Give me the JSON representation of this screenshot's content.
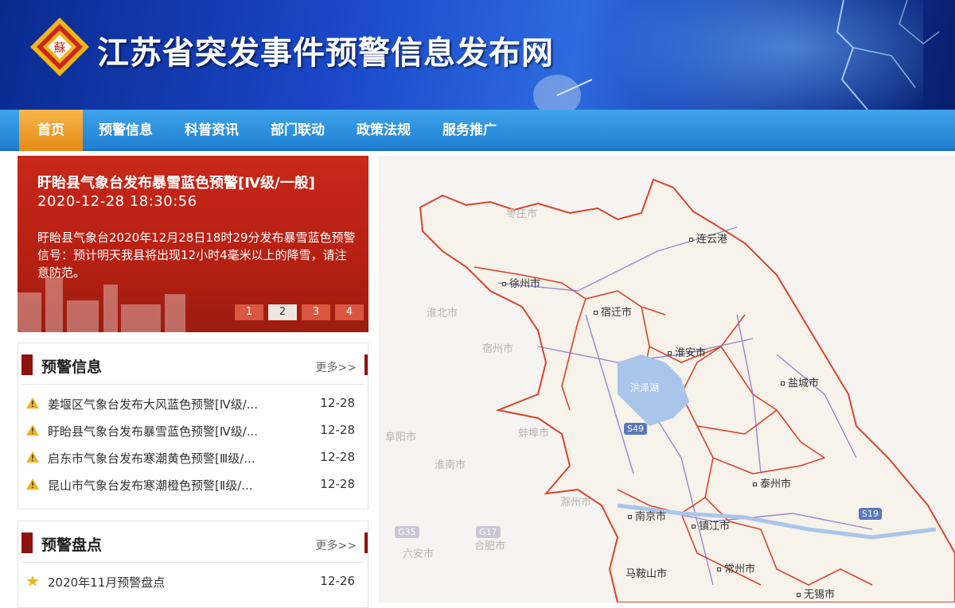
{
  "header": {
    "site_title": "江苏省突发事件预警信息发布网",
    "logo_char": "蘇"
  },
  "nav": {
    "items": [
      "首页",
      "预警信息",
      "科普资讯",
      "部门联动",
      "政策法规",
      "服务推广"
    ],
    "active_index": 0
  },
  "slider": {
    "title": "盱眙县气象台发布暴雪蓝色预警[Ⅳ级/一般]",
    "time": "2020-12-28 18:30:56",
    "body": "盱眙县气象台2020年12月28日18时29分发布暴雪蓝色预警信号：预计明天我县将出现12小时4毫米以上的降雪，请注意防范。",
    "pages": [
      "1",
      "2",
      "3",
      "4"
    ],
    "current_page": "2"
  },
  "warnings_panel": {
    "title": "预警信息",
    "more": "更多>>",
    "items": [
      {
        "text": "姜堰区气象台发布大风蓝色预警[Ⅳ级/...",
        "date": "12-28",
        "icon": "warning-icon"
      },
      {
        "text": "盱眙县气象台发布暴雪蓝色预警[Ⅳ级/...",
        "date": "12-28",
        "icon": "warning-icon"
      },
      {
        "text": "启东市气象台发布寒潮黄色预警[Ⅲ级/...",
        "date": "12-28",
        "icon": "warning-icon"
      },
      {
        "text": "昆山市气象台发布寒潮橙色预警[Ⅱ级/...",
        "date": "12-28",
        "icon": "warning-icon"
      }
    ]
  },
  "summary_panel": {
    "title": "预警盘点",
    "more": "更多>>",
    "items": [
      {
        "text": "2020年11月预警盘点",
        "date": "12-26",
        "icon": "star-icon"
      }
    ]
  },
  "map": {
    "cities": [
      "连云港",
      "徐州市",
      "宿迁市",
      "淮安市",
      "盐城市",
      "泰州市",
      "南京市",
      "镇江市",
      "常州市",
      "无锡市"
    ],
    "faint_places": [
      "枣庄市",
      "淮北市",
      "宿州市",
      "阜阳市",
      "蚌埠市",
      "淮南市",
      "滁州市",
      "六安市",
      "合肥市",
      "马鞍山市"
    ],
    "lake": "洪泽湖",
    "roads": [
      "S49",
      "S19",
      "G35",
      "G17"
    ],
    "colors": {
      "border": "#d9432c",
      "land": "#f7f2ea",
      "road": "#7b6fc6",
      "water": "#a9c5ea"
    }
  },
  "colors": {
    "header": "#1a47c7",
    "nav": "#2b8fe0",
    "nav_active": "#ed9a24",
    "alert_box": "#c0241a",
    "panel_accent": "#8d1310"
  }
}
